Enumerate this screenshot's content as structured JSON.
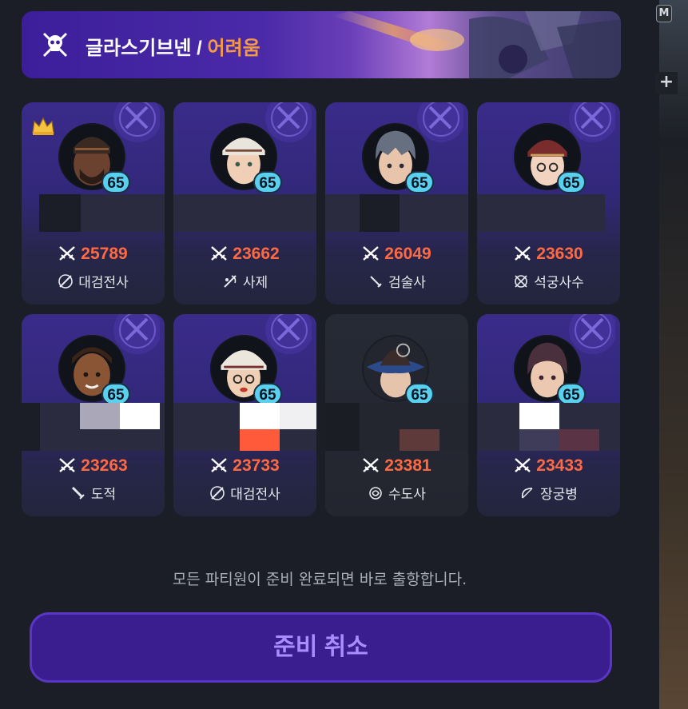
{
  "banner": {
    "dungeon": "글라스기브넨",
    "separator": " / ",
    "difficulty": "어려움"
  },
  "party": [
    {
      "level": "65",
      "power": "25789",
      "class_name": "대검전사",
      "leader": true
    },
    {
      "level": "65",
      "power": "23662",
      "class_name": "사제",
      "leader": false
    },
    {
      "level": "65",
      "power": "26049",
      "class_name": "검술사",
      "leader": false
    },
    {
      "level": "65",
      "power": "23630",
      "class_name": "석궁사수",
      "leader": false
    },
    {
      "level": "65",
      "power": "23263",
      "class_name": "도적",
      "leader": false
    },
    {
      "level": "65",
      "power": "23733",
      "class_name": "대검전사",
      "leader": false
    },
    {
      "level": "65",
      "power": "23381",
      "class_name": "수도사",
      "leader": false
    },
    {
      "level": "65",
      "power": "23433",
      "class_name": "장궁병",
      "leader": false
    }
  ],
  "footer": {
    "note": "모든 파티원이 준비 완료되면 바로 출항합니다.",
    "cancel_label": "준비 취소"
  },
  "side": {
    "m_key": "M",
    "plus": "+"
  },
  "colors": {
    "accent_purple": "#3a1d8e",
    "power_orange": "#ff6a45",
    "level_cyan": "#5ad0ef",
    "difficulty_orange": "#f59a44"
  }
}
